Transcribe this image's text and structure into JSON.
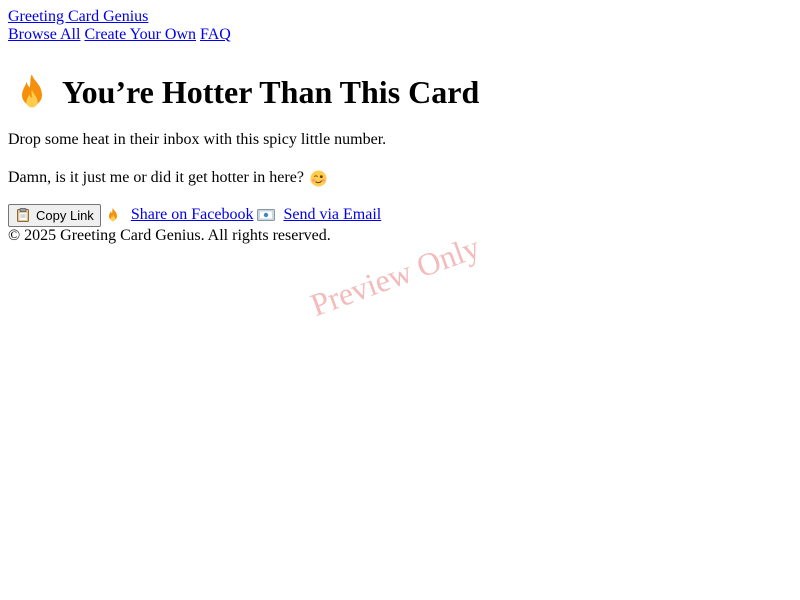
{
  "header": {
    "site_title": "Greeting Card Genius",
    "nav": [
      {
        "label": "Browse All"
      },
      {
        "label": "Create Your Own"
      },
      {
        "label": "FAQ"
      }
    ]
  },
  "card": {
    "icon": "fire-icon",
    "title": "You’re Hotter Than This Card",
    "tagline": "Drop some heat in their inbox with this spicy little number.",
    "message": "Damn, is it just me or did it get hotter in here?",
    "message_icon": "woozy-face-icon"
  },
  "actions": {
    "copy_label": "Copy Link",
    "copy_icon": "clipboard-icon",
    "facebook_label": "Share on Facebook",
    "facebook_icon": "fire-icon",
    "email_label": "Send via Email",
    "email_icon": "envelope-icon"
  },
  "footer": {
    "text": "© 2025 Greeting Card Genius. All rights reserved."
  },
  "watermark": {
    "text": "Preview Only"
  },
  "colors": {
    "link": "#0000ee",
    "watermark": "#dc3c3c",
    "flame_outer": "#f4900c",
    "flame_inner": "#ffcc4d"
  }
}
